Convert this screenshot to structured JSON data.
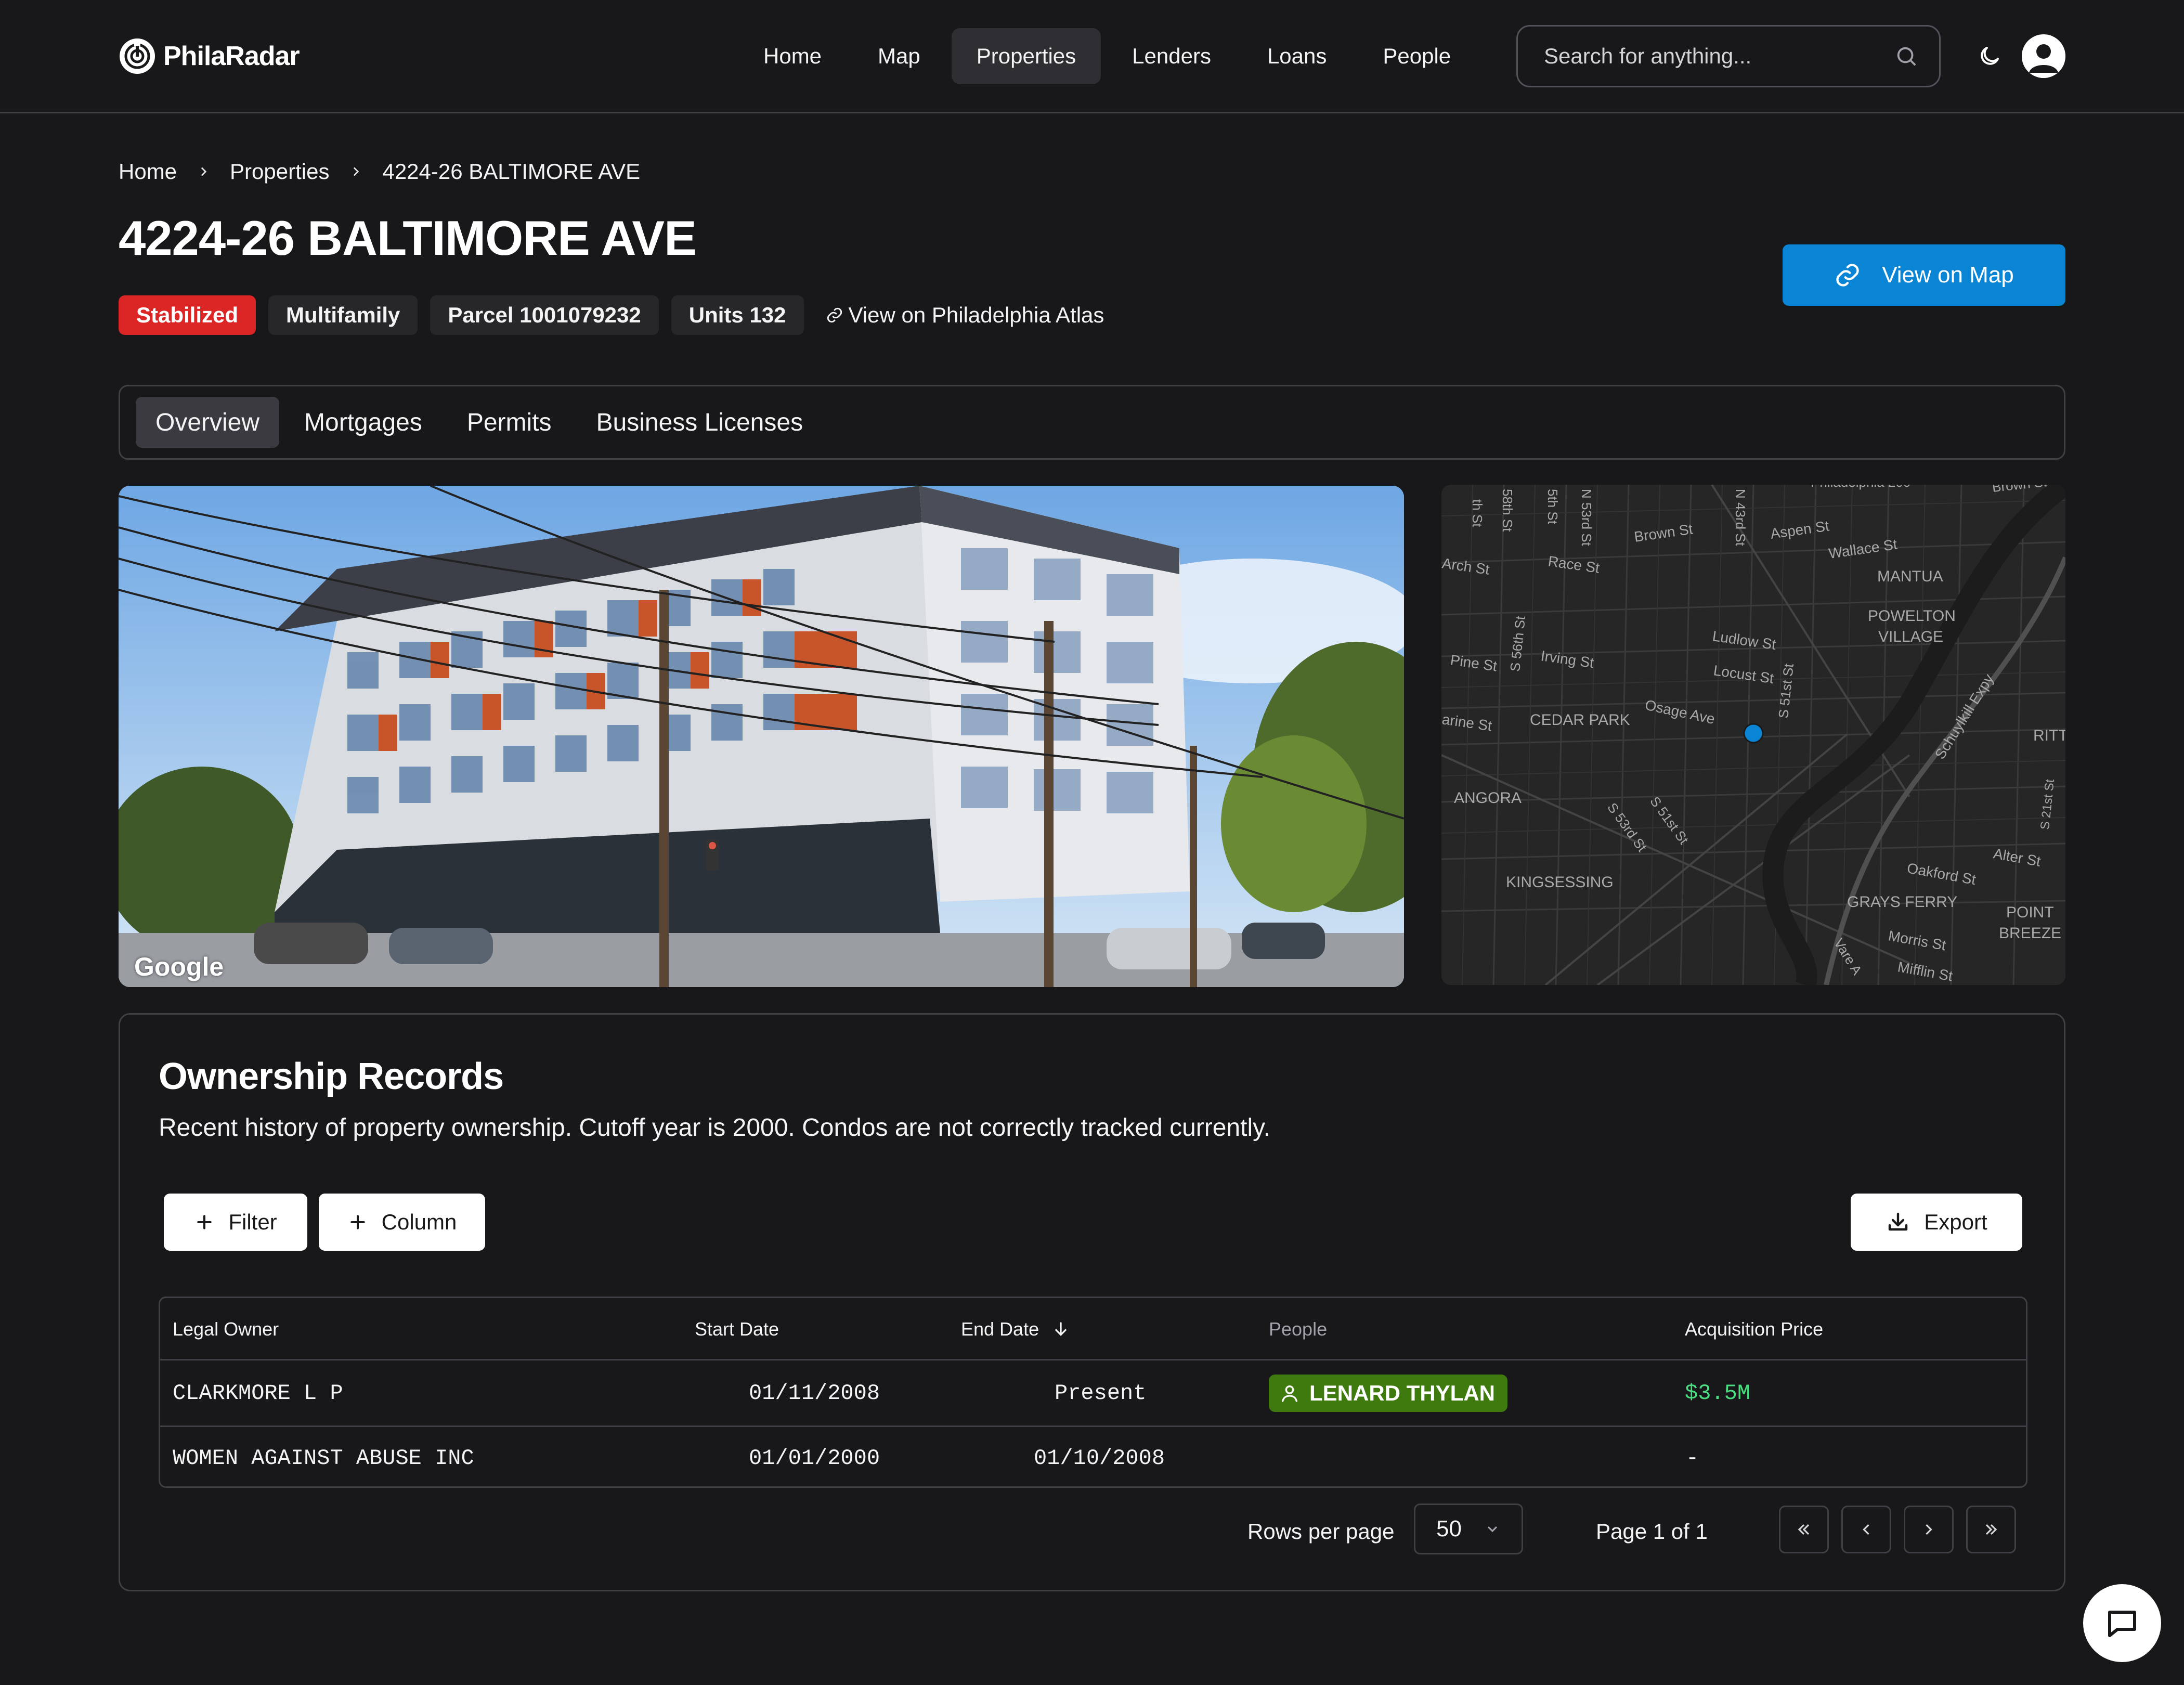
{
  "app": {
    "name": "PhilaRadar"
  },
  "nav": {
    "items": [
      {
        "label": "Home"
      },
      {
        "label": "Map"
      },
      {
        "label": "Properties",
        "active": true
      },
      {
        "label": "Lenders"
      },
      {
        "label": "Loans"
      },
      {
        "label": "People"
      }
    ]
  },
  "search": {
    "placeholder": "Search for anything..."
  },
  "breadcrumb": {
    "home": "Home",
    "properties": "Properties",
    "current": "4224-26 BALTIMORE AVE"
  },
  "property": {
    "title": "4224-26 BALTIMORE AVE",
    "status": "Stabilized",
    "type": "Multifamily",
    "parcel": "Parcel 1001079232",
    "units": "Units 132",
    "atlas_link": "View on Philadelphia Atlas",
    "view_map_label": "View on Map"
  },
  "tabs": [
    "Overview",
    "Mortgages",
    "Permits",
    "Business Licenses"
  ],
  "street_view": {
    "attribution": "Google"
  },
  "map": {
    "labels": {
      "l1": "th St",
      "l2": "58th St",
      "l3": "5th St",
      "l4": "N 53rd St",
      "l5": "Brown St",
      "l6": "N 43rd St",
      "l7": "Aspen St",
      "l8": "Wallace St",
      "l9": "Arch St",
      "l10": "Race St",
      "l11": "MANTUA",
      "l12": "POWELTON",
      "l13": "VILLAGE",
      "l14": "S 56th St",
      "l15": "Ludlow St",
      "l16": "Pine St",
      "l17": "Irving St",
      "l18": "Locust St",
      "l19": "S 51st St",
      "l20": "Osage Ave",
      "l21": "arine St",
      "l22": "CEDAR PARK",
      "l23": "Schuylkill Expy",
      "l24": "ANGORA",
      "l25": "S 53rd St",
      "l26": "S 51st St",
      "l27": "KINGSESSING",
      "l28": "Oakford St",
      "l29": "Alter St",
      "l30": "GRAYS FERRY",
      "l31": "POINT",
      "l32": "BREEZE",
      "l33": "Morris St",
      "l34": "Mifflin St",
      "l35": "Vare A",
      "l36": "RITT",
      "l37": "S 21st St",
      "l38": "Philadelphia 200",
      "l39": "Brown St"
    }
  },
  "ownership": {
    "title": "Ownership Records",
    "subtitle": "Recent history of property ownership. Cutoff year is 2000. Condos are not correctly tracked currently.",
    "filter_label": "Filter",
    "column_label": "Column",
    "export_label": "Export",
    "columns": {
      "legal_owner": "Legal Owner",
      "start_date": "Start Date",
      "end_date": "End Date",
      "people": "People",
      "acquisition_price": "Acquisition Price"
    },
    "rows": [
      {
        "legal_owner": "CLARKMORE L P",
        "start_date": "01/11/2008",
        "end_date": "Present",
        "people": "LENARD THYLAN",
        "acquisition_price": "$3.5M"
      },
      {
        "legal_owner": "WOMEN AGAINST ABUSE INC",
        "start_date": "01/01/2000",
        "end_date": "01/10/2008",
        "people": "",
        "acquisition_price": "-"
      }
    ],
    "pagination": {
      "rows_per_page_label": "Rows per page",
      "rows_per_page_value": "50",
      "page_info": "Page 1 of 1"
    }
  },
  "colors": {
    "background": "#18181b",
    "accent_blue": "#0a84d4",
    "status_red": "#dc2626",
    "person_green": "#3f7a0e",
    "price_green": "#4ade80"
  },
  "icons": {
    "logo": "radar-logo-icon",
    "search": "search-icon",
    "theme": "moon-icon",
    "avatar": "user-avatar-icon",
    "breadcrumb_sep": "chevron-right-icon",
    "link": "link-icon",
    "plus": "plus-icon",
    "export": "download-icon",
    "sort": "arrow-down-icon",
    "person": "user-icon",
    "chat": "chat-icon"
  }
}
